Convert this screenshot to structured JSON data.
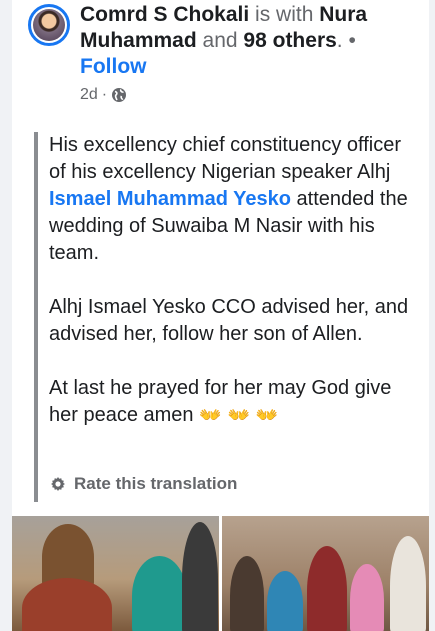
{
  "header": {
    "author": "Comrd S Chokali",
    "with_text": "is with",
    "tagged_name": "Nura Muhammad",
    "and_text": "and",
    "others_text": "98 others",
    "separator": ". •",
    "follow_label": "Follow",
    "time": "2d",
    "time_separator": "·"
  },
  "post": {
    "p1_before": "His excellency chief constituency officer of his excellency Nigerian speaker Alhj ",
    "p1_mention": "Ismael Muhammad Yesko",
    "p1_after": " attended the wedding of Suwaiba M Nasir with his team.",
    "p2": "Alhj Ismael Yesko CCO advised her, and advised her, follow her son of Allen.",
    "p3": "At last he prayed for her may God give her peace amen",
    "p3_emoji": "👐👐👐"
  },
  "translation": {
    "rate_label": "Rate this translation"
  },
  "icons": {
    "avatar": "profile-avatar",
    "privacy": "globe-icon",
    "rate": "gear-icon"
  },
  "colors": {
    "link": "#1877f2",
    "text": "#1c1e21",
    "muted": "#65676b",
    "quote_bar": "#8a8d91"
  }
}
